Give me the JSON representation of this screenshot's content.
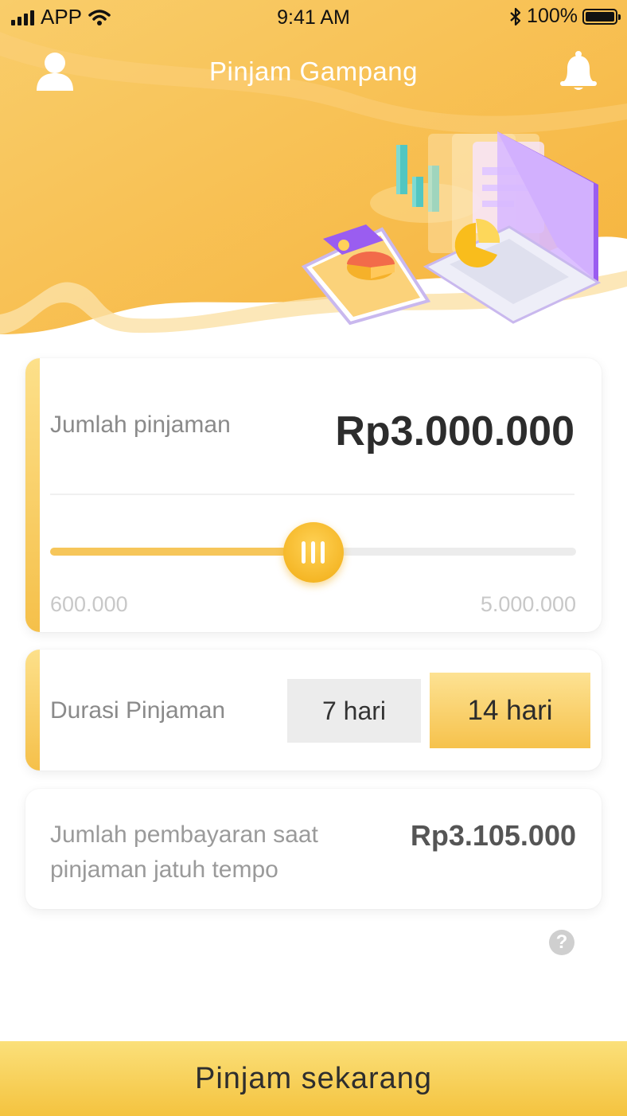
{
  "status_bar": {
    "carrier": "APP",
    "time": "9:41 AM",
    "battery": "100%"
  },
  "header": {
    "title": "Pinjam Gampang",
    "left_icon": "user-icon",
    "right_icon": "bell-icon"
  },
  "loan_amount": {
    "label": "Jumlah pinjaman",
    "value": "Rp3.000.000",
    "min_label": "600.000",
    "max_label": "5.000.000",
    "slider_fraction": 0.5
  },
  "duration": {
    "label": "Durasi Pinjaman",
    "options": [
      {
        "label": "7 hari",
        "selected": false
      },
      {
        "label": "14 hari",
        "selected": true
      }
    ]
  },
  "repayment": {
    "label": "Jumlah pembayaran saat pinjaman jatuh tempo",
    "value": "Rp3.105.000"
  },
  "help": {
    "icon": "question-icon",
    "glyph": "?"
  },
  "cta": {
    "label": "Pinjam sekarang"
  },
  "colors": {
    "accent": "#f6c24c",
    "accent_light": "#fde293",
    "header_bg": "#f8c659"
  }
}
